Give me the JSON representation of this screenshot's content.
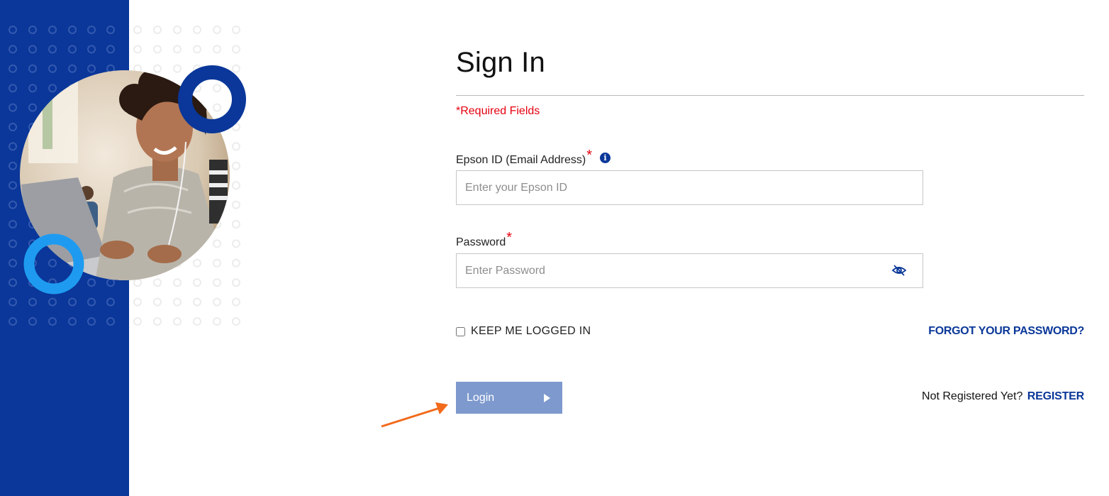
{
  "page": {
    "title": "Sign In",
    "required_note": "*Required Fields"
  },
  "form": {
    "email": {
      "label": "Epson ID (Email Address)",
      "required_marker": "*",
      "placeholder": "Enter your Epson ID",
      "info_icon": "info-icon"
    },
    "password": {
      "label": "Password",
      "required_marker": "*",
      "placeholder": "Enter Password",
      "toggle_icon": "eye-slash-icon"
    },
    "keep_logged_in": {
      "label": "KEEP ME LOGGED IN",
      "checked": false
    },
    "forgot_password": "FORGOT YOUR PASSWORD?",
    "login_button": "Login",
    "register_prompt": "Not Registered Yet?",
    "register_link": "REGISTER"
  },
  "colors": {
    "brand_blue": "#0a3799",
    "accent_light_blue": "#1e9bf0",
    "required_red": "#e4000f",
    "login_button_bg": "#7d99cd",
    "annotation_orange": "#f26a1b"
  },
  "annotation": {
    "arrow_icon": "orange-arrow-icon",
    "points_to": "login-button"
  }
}
